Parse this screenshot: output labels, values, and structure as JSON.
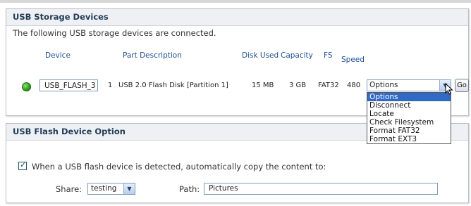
{
  "storage_panel": {
    "title": "USB Storage Devices",
    "note": "The following USB storage devices are connected.",
    "columns": [
      "Device",
      "Part Description",
      "Disk Used",
      "Capacity",
      "FS",
      "Speed"
    ],
    "devices": [
      {
        "status": "connected",
        "status_color": "#2fa41c",
        "device": "USB_FLASH_3",
        "partition_number": "1",
        "part_description": "USB 2.0 Flash Disk [Partition 1]",
        "disk_used": "15 MB",
        "capacity": "3 GB",
        "fs": "FAT32",
        "speed": "480",
        "action_selected": "Options",
        "go_label": "Go"
      }
    ],
    "action_options": [
      "Options",
      "Disconnect",
      "Locate",
      "Check Filesystem",
      "Format FAT32",
      "Format EXT3"
    ],
    "highlight_color": "#316ac5"
  },
  "flash_option_panel": {
    "title": "USB Flash Device Option",
    "checkbox_label": "When a USB flash device is detected, automatically copy the content to:",
    "checkbox_checked": true,
    "share_label": "Share:",
    "share_value": "testing",
    "path_label": "Path:",
    "path_value": "Pictures"
  },
  "icons": {
    "status": "status-led-icon",
    "dropdown": "chevron-down-icon",
    "cursor": "mouse-cursor-icon",
    "checkmark": "checkmark-icon"
  }
}
